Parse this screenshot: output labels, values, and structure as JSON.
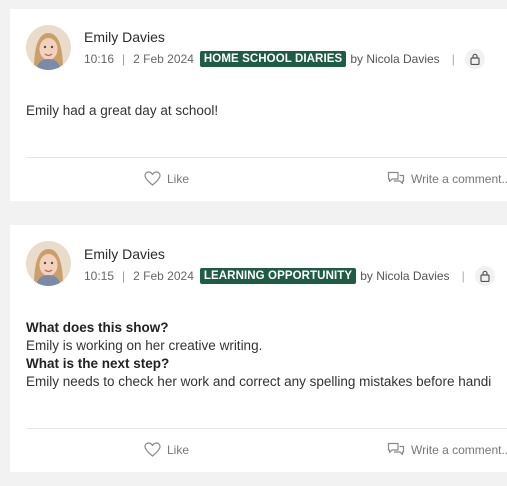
{
  "posts": [
    {
      "author": "Emily Davies",
      "time": "10:16",
      "date": "2 Feb 2024",
      "tag": "HOME SCHOOL DIARIES",
      "by": "by Nicola Davies",
      "body": "Emily had a great day at school!",
      "like_label": "Like",
      "comment_label": "Write a comment..."
    },
    {
      "author": "Emily Davies",
      "time": "10:15",
      "date": "2 Feb 2024",
      "tag": "LEARNING OPPORTUNITY",
      "by": "by Nicola Davies",
      "q1": "What does this show?",
      "a1": "Emily is working on her creative writing.",
      "q2": "What is the next step?",
      "a2": "Emily needs to check her work and correct any spelling mistakes before handi",
      "like_label": "Like",
      "comment_label": "Write a comment..."
    }
  ],
  "colors": {
    "tag_bg": "#1e5c45",
    "page_bg": "#f2f2f2"
  },
  "icons": [
    "avatar",
    "lock-icon",
    "heart-icon",
    "comment-icon"
  ]
}
